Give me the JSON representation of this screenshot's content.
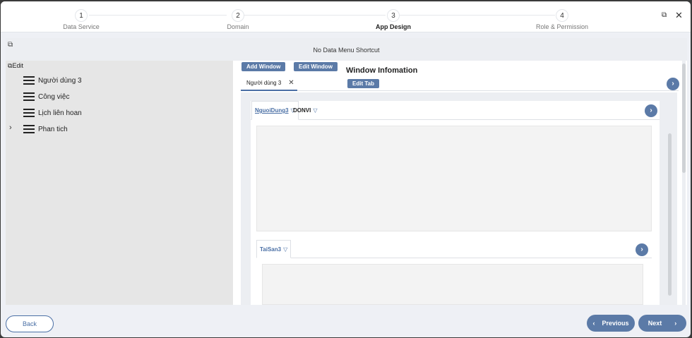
{
  "stepper": {
    "steps": [
      {
        "num": "1",
        "label": "Data Service"
      },
      {
        "num": "2",
        "label": "Domain"
      },
      {
        "num": "3",
        "label": "App Design"
      },
      {
        "num": "4",
        "label": "Role & Permission"
      }
    ],
    "active_index": 2
  },
  "window_controls": {
    "restore_icon": "restore-icon",
    "close_icon": "close-icon"
  },
  "shortcut": {
    "title": "No Data Menu Shortcut",
    "icon": "external-link-icon"
  },
  "tree": {
    "edit_label": "Edit",
    "items": [
      {
        "label": "Người dùng 3",
        "expandable": false
      },
      {
        "label": "Công việc",
        "expandable": false
      },
      {
        "label": "Lịch liên hoan",
        "expandable": false
      },
      {
        "label": "Phan tich",
        "expandable": true
      }
    ]
  },
  "editor": {
    "add_window": "Add Window",
    "edit_window": "Edit Window",
    "window_info": "Window Infomation",
    "edit_tab": "Edit Tab",
    "active_tab": "Người dùng 3",
    "sub_tabs": [
      "NguoiDung3",
      "DONVI"
    ],
    "nested_tab": "TaiSan3"
  },
  "footer": {
    "back": "Back",
    "previous": "Previous",
    "next": "Next"
  },
  "colors": {
    "accent": "#5b7aa7",
    "link": "#4a6fa5"
  }
}
